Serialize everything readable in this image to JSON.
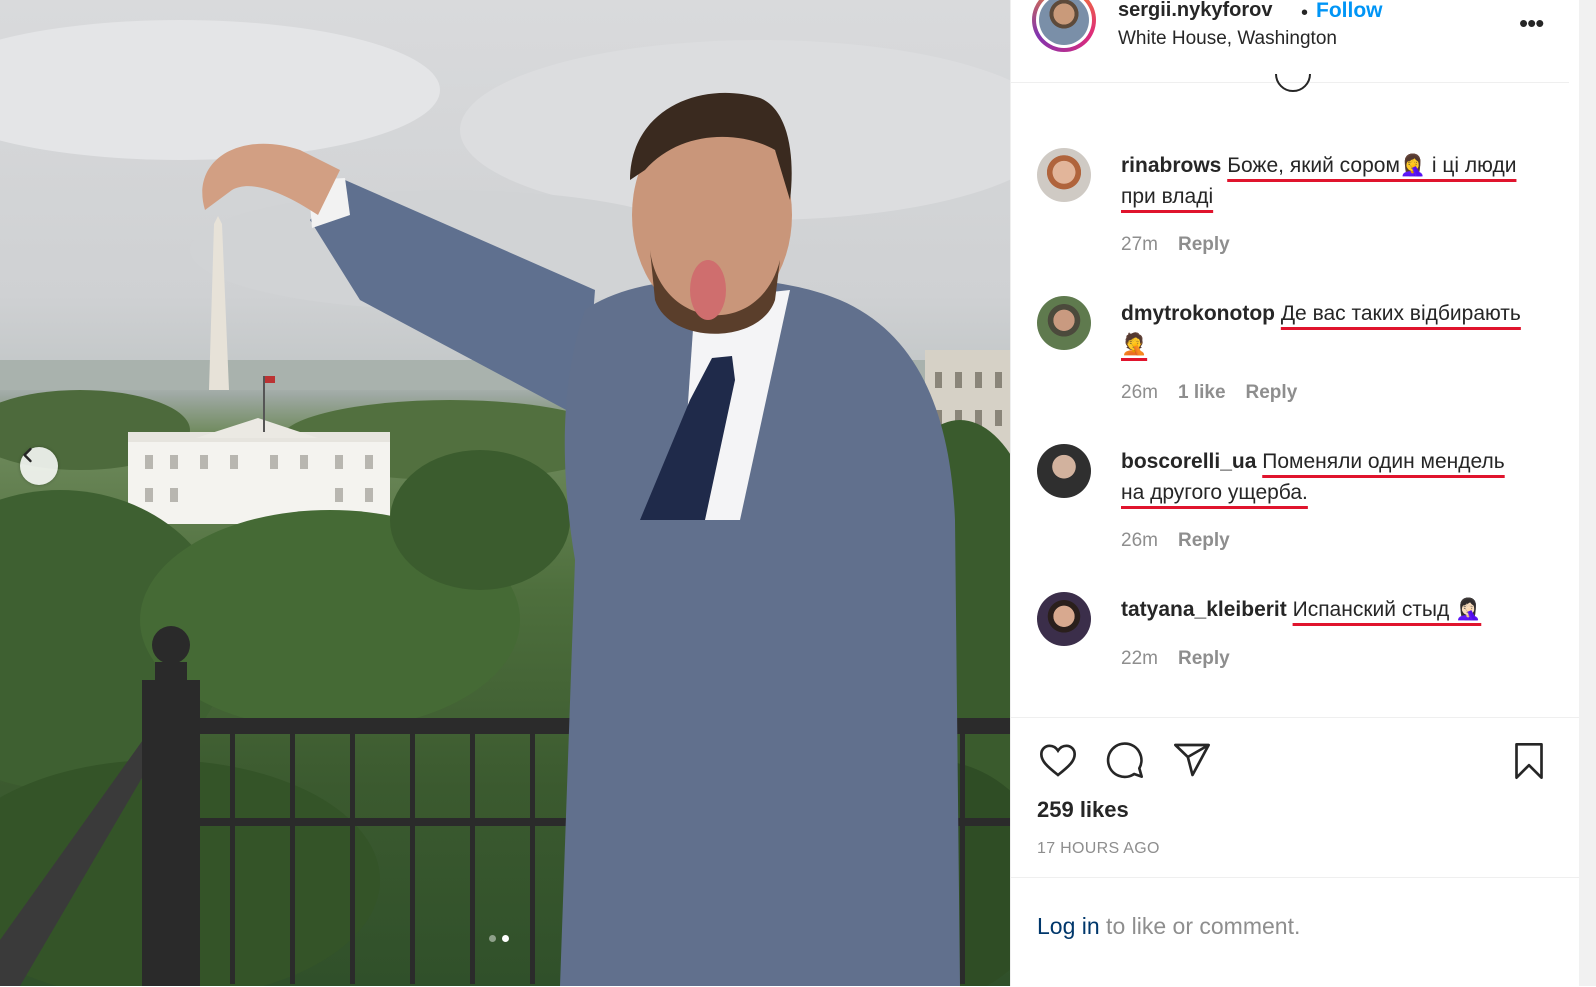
{
  "post": {
    "photo_carousel": {
      "dot_count": 2,
      "active_dot": 2
    },
    "header": {
      "username": "sergii.nykyforov",
      "separator": "•",
      "follow_label": "Follow",
      "location": "White House, Washington",
      "more_icon": "more-horizontal-icon"
    },
    "comments": [
      {
        "username": "rinabrows",
        "text": "Боже, який сором🤦‍♀️ і ці люди при владі",
        "time": "27m",
        "likes": "",
        "reply": "Reply"
      },
      {
        "username": "dmytrokonotop",
        "text": "Де вас таких відбирають 🤦",
        "time": "26m",
        "likes": "1 like",
        "reply": "Reply"
      },
      {
        "username": "boscorelli_ua",
        "text": "Поменяли один мендель на другого ущерба.",
        "time": "26m",
        "likes": "",
        "reply": "Reply"
      },
      {
        "username": "tatyana_kleiberit",
        "text": "Испанский стыд 🤦🏻‍♀️",
        "time": "22m",
        "likes": "",
        "reply": "Reply"
      }
    ],
    "actions": {
      "like_icon": "heart-icon",
      "comment_icon": "comment-icon",
      "share_icon": "paper-plane-icon",
      "save_icon": "bookmark-icon"
    },
    "likes_label": "259 likes",
    "timestamp": "17 HOURS AGO",
    "login": {
      "link": "Log in",
      "rest": " to like or comment."
    }
  },
  "colors": {
    "accent": "#0095f6",
    "underline": "#e0142d",
    "muted": "#8e8e8e"
  }
}
